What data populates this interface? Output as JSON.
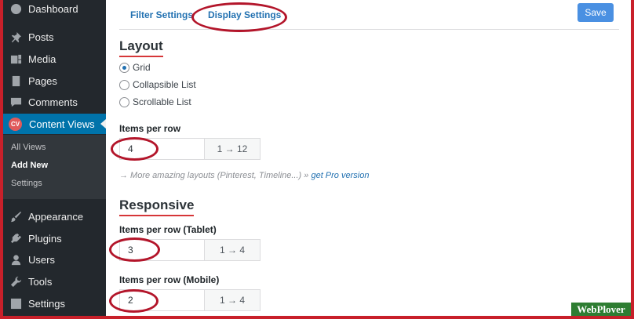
{
  "sidebar": {
    "items": [
      {
        "label": "Dashboard",
        "icon": "dashboard-icon"
      },
      {
        "label": "Posts",
        "icon": "pin-icon"
      },
      {
        "label": "Media",
        "icon": "media-icon"
      },
      {
        "label": "Pages",
        "icon": "pages-icon"
      },
      {
        "label": "Comments",
        "icon": "comment-icon"
      },
      {
        "label": "Content Views",
        "icon": "cv-logo-icon",
        "badge": "CV"
      },
      {
        "label": "Appearance",
        "icon": "brush-icon"
      },
      {
        "label": "Plugins",
        "icon": "plug-icon"
      },
      {
        "label": "Users",
        "icon": "user-icon"
      },
      {
        "label": "Tools",
        "icon": "wrench-icon"
      },
      {
        "label": "Settings",
        "icon": "settings-icon"
      }
    ],
    "submenu": [
      "All Views",
      "Add New",
      "Settings"
    ]
  },
  "tabs": [
    "Filter Settings",
    "Display Settings"
  ],
  "save_label": "Save",
  "layout": {
    "title": "Layout",
    "options": [
      "Grid",
      "Collapsible List",
      "Scrollable List"
    ],
    "selected": "Grid",
    "items_per_row": {
      "label": "Items per row",
      "value": "4",
      "range": "1 → 12"
    },
    "promo_text": "→ More amazing layouts (Pinterest, Timeline...) »",
    "promo_link": "get Pro version"
  },
  "responsive": {
    "title": "Responsive",
    "tablet": {
      "label": "Items per row (Tablet)",
      "value": "3",
      "range": "1 → 4"
    },
    "mobile": {
      "label": "Items per row (Mobile)",
      "value": "2",
      "range": "1 → 4"
    }
  },
  "watermark": "WebPlover",
  "colors": {
    "accent": "#0073aa",
    "highlight": "#b3152a",
    "brand": "#2e7d32"
  }
}
